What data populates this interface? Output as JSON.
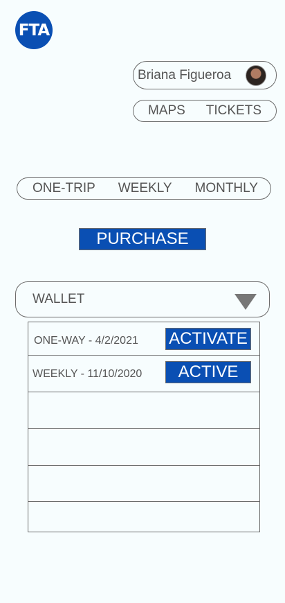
{
  "logo": {
    "text": "FTA"
  },
  "user": {
    "name": "Briana Figueroa"
  },
  "nav": {
    "maps": "MAPS",
    "tickets": "TICKETS"
  },
  "ticket_types": {
    "one_trip": "ONE-TRIP",
    "weekly": "WEEKLY",
    "monthly": "MONTHLY"
  },
  "purchase_label": "PURCHASE",
  "wallet": {
    "selected": "WALLET",
    "items": [
      {
        "label": "ONE-WAY - 4/2/2021",
        "action": "ACTIVATE"
      },
      {
        "label": "WEEKLY - 11/10/2020",
        "action": "ACTIVE"
      }
    ]
  },
  "colors": {
    "accent": "#0a4fb3",
    "background": "#f7fdfe",
    "border": "#6b6b6b"
  }
}
